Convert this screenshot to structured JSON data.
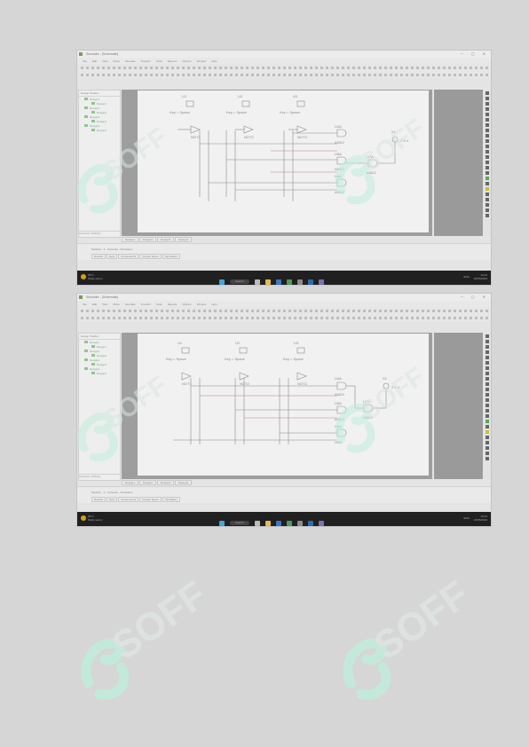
{
  "window": {
    "title": "Simulator - [Schematic]",
    "menu": [
      "File",
      "Edit",
      "View",
      "Place",
      "Simulate",
      "Transfer",
      "Tools",
      "Reports",
      "Options",
      "Window",
      "Help"
    ]
  },
  "tree": {
    "header": "Design Toolbox",
    "items": [
      {
        "label": "Design1",
        "sub": false
      },
      {
        "label": "Design1",
        "sub": true
      },
      {
        "label": "Design2",
        "sub": false
      },
      {
        "label": "Design2",
        "sub": true
      },
      {
        "label": "Design3",
        "sub": false
      },
      {
        "label": "Design3",
        "sub": true
      },
      {
        "label": "Design4",
        "sub": false
      },
      {
        "label": "Design4",
        "sub": true
      }
    ],
    "tabs": [
      "Hierarchy",
      "Visibility"
    ]
  },
  "sheet_tabs": [
    "Design1",
    "Design2",
    "Design3",
    "Design4"
  ],
  "output": {
    "line": "Multisim - 1 : Contents - Simulation",
    "tabs": [
      "Results",
      "Nets",
      "Components",
      "Copper layers",
      "Simulation"
    ]
  },
  "taskbar": {
    "weather_temp": "25°C",
    "weather_desc": "Partly sunny",
    "search": "Search",
    "tray_icons": "ENG",
    "time": "10:24",
    "date": "20/05/2023"
  },
  "schematic1": {
    "sources": [
      {
        "ref": "U1",
        "name": "Key = Space"
      },
      {
        "ref": "U2",
        "name": "Key = Space"
      },
      {
        "ref": "U3",
        "name": "Key = Space"
      }
    ],
    "gates": [
      "NOT1",
      "NOT2",
      "NOT3"
    ],
    "ands": [
      "U4A",
      "U5A",
      "U6A",
      "U7A",
      "U8A"
    ],
    "ands_types": [
      "AND2",
      "AND2",
      "AND2",
      "AND2",
      "AND2"
    ],
    "probe": {
      "ref": "X1",
      "value": "2.5 V"
    }
  },
  "schematic2": {
    "sources": [
      {
        "ref": "U1",
        "name": "Key = Space"
      },
      {
        "ref": "U2",
        "name": "Key = Space"
      },
      {
        "ref": "U3",
        "name": "Key = Space"
      }
    ],
    "gates": [
      "NOT1",
      "NOT2",
      "NOT3"
    ],
    "ands": [
      "U4A",
      "U5A",
      "U6A",
      "U7A"
    ],
    "ands_types": [
      "AND3",
      "AND3",
      "OR3",
      "AND3"
    ],
    "probe": {
      "ref": "X1",
      "value": "2.5 V"
    }
  },
  "watermark": "SOFF",
  "colors": {
    "watermark": "#bfeedd",
    "taskbar": "#202020",
    "tree_icon": "#93c48d"
  }
}
